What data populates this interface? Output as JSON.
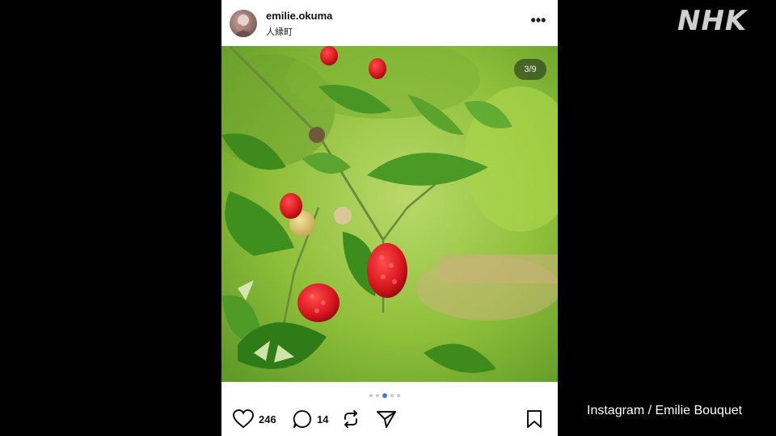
{
  "post": {
    "username": "emilie.okuma",
    "location": "人縁町",
    "photo_counter": "3/9",
    "carousel_total_dots": 6,
    "carousel_active_index": 2,
    "likes": "246",
    "comments": "14"
  },
  "icons": {
    "more": "more-options-icon",
    "like": "heart-icon",
    "comment": "comment-bubble-icon",
    "repost": "repost-icon",
    "share": "send-icon",
    "save": "bookmark-icon"
  },
  "broadcast": {
    "logo": "NHK",
    "credit": "Instagram / Emilie Bouquet"
  },
  "colors": {
    "dot_active": "#3d7bd9",
    "background": "#000000"
  }
}
